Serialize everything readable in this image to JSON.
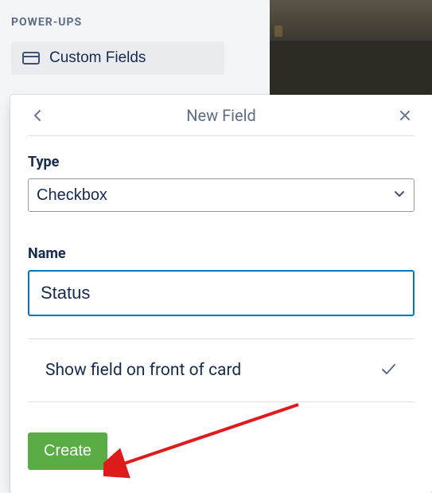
{
  "sidebar": {
    "section_title": "POWER-UPS",
    "custom_fields_label": "Custom Fields"
  },
  "modal": {
    "title": "New Field",
    "type_label": "Type",
    "type_value": "Checkbox",
    "name_label": "Name",
    "name_value": "Status",
    "toggle_label": "Show field on front of card",
    "create_label": "Create"
  }
}
